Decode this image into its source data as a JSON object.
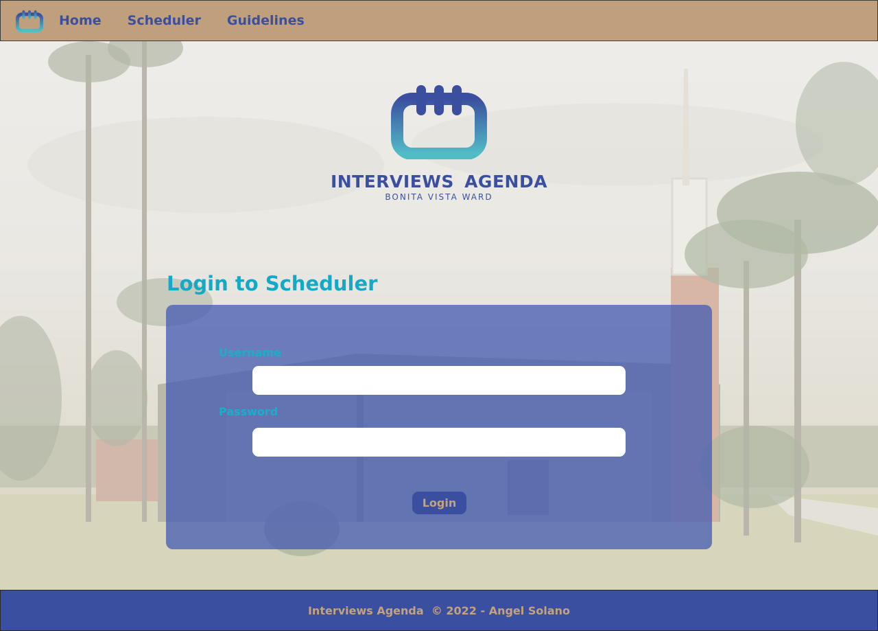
{
  "nav": {
    "logo_icon": "calendar-logo-icon",
    "links": [
      "Home",
      "Scheduler",
      "Guidelines"
    ]
  },
  "hero": {
    "logo_icon": "calendar-logo-icon",
    "title": "INTERVIEWS AGENDA",
    "subtitle": "BONITA VISTA WARD"
  },
  "login": {
    "heading": "Login to Scheduler",
    "username_label": "Username",
    "username_value": "",
    "password_label": "Password",
    "password_value": "",
    "button_label": "Login"
  },
  "footer": {
    "text": "Interviews Agenda  © 2022 - Angel Solano"
  },
  "colors": {
    "navbar_bg": "#c0a07c",
    "brand_blue": "#3b4fa0",
    "accent_cyan": "#14a9c6",
    "gold_text": "#c4a37c"
  }
}
